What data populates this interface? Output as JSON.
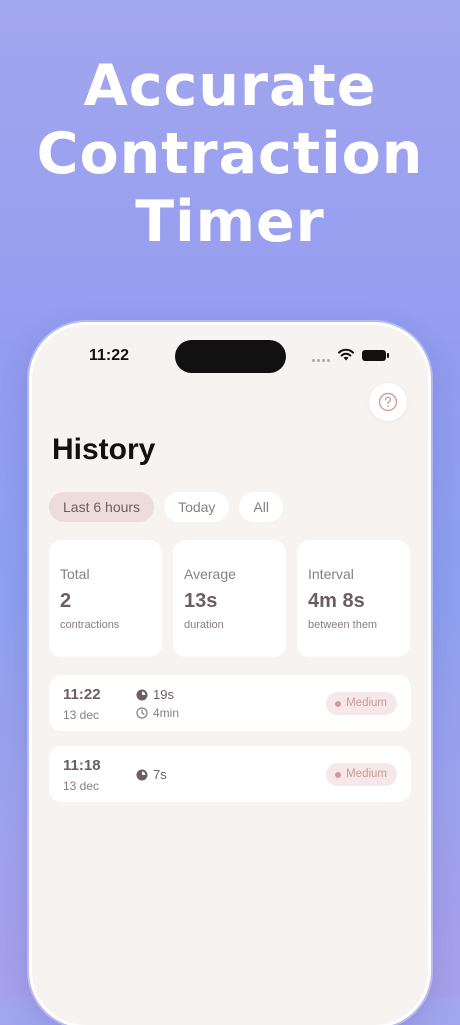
{
  "headline": {
    "line1": "Accurate",
    "line2": "Contraction",
    "line3": "Timer"
  },
  "status_bar": {
    "time": "11:22"
  },
  "help_button": {
    "icon": "question-circle-icon",
    "color": "#d4a0a0"
  },
  "page_title": "History",
  "filters": [
    {
      "label": "Last 6 hours",
      "active": true
    },
    {
      "label": "Today",
      "active": false
    },
    {
      "label": "All",
      "active": false
    }
  ],
  "stats": [
    {
      "label": "Total",
      "value": "2",
      "sub": "contractions"
    },
    {
      "label": "Average",
      "value": "13s",
      "sub": "duration"
    },
    {
      "label": "Interval",
      "value": "4m 8s",
      "sub": "between them"
    }
  ],
  "entries": [
    {
      "time": "11:22",
      "date": "13 dec",
      "duration": "19s",
      "interval": "4min",
      "intensity": "Medium"
    },
    {
      "time": "11:18",
      "date": "13 dec",
      "duration": "7s",
      "interval": "",
      "intensity": "Medium"
    }
  ],
  "colors": {
    "background_top": "#a3a6ee",
    "screen_bg": "#f7f3f1",
    "accent_text": "#6b5e61",
    "muted_text": "#8a7d7f",
    "active_chip": "#ecdcdc",
    "badge_bg": "#f6e8e8",
    "badge_text": "#cc9a9a"
  }
}
